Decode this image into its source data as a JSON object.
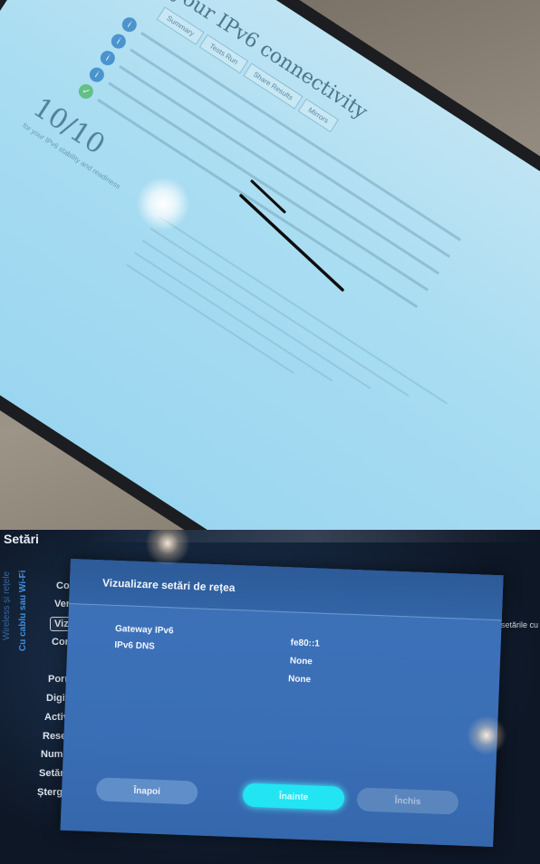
{
  "top_photo": {
    "page_title": "your IPv6 connectivity",
    "tabs": [
      "Summary",
      "Tests Run",
      "Share Results",
      "Mirrors"
    ],
    "test_items": [
      {
        "icon": "info-icon",
        "status": "blue"
      },
      {
        "icon": "info-icon",
        "status": "blue"
      },
      {
        "icon": "info-icon",
        "status": "blue"
      },
      {
        "icon": "info-icon",
        "status": "blue"
      },
      {
        "icon": "check-icon",
        "status": "green"
      }
    ],
    "score": "10/10",
    "score_caption": "for your IPv6 stability and readiness"
  },
  "tv": {
    "header_title": "Setări",
    "vertical_tabs": [
      "Wireless și rețele",
      "Cu cablu sau Wi-Fi"
    ],
    "menu_items": [
      "Conect",
      "Verifica",
      "Vizuali",
      "Configu",
      "Pornire",
      "Digital",
      "Activar",
      "Reseta",
      "Nume",
      "Setări",
      "Ștergere"
    ],
    "selected_menu_index": 2,
    "right_hint": "setările cu",
    "dialog": {
      "title": "Vizualizare setări de rețea",
      "rows": [
        {
          "label": "Gateway IPv6",
          "value": "fe80::1"
        },
        {
          "label": "IPv6 DNS",
          "value": "None"
        },
        {
          "label": "",
          "value": "None"
        }
      ],
      "buttons": {
        "back": "Înapoi",
        "next": "Înainte",
        "close": "Închis"
      }
    },
    "colors": {
      "dialog_bg": "#3d72b9",
      "accent_button": "#22e4f2",
      "tab_blue": "#3f8fe0"
    }
  }
}
